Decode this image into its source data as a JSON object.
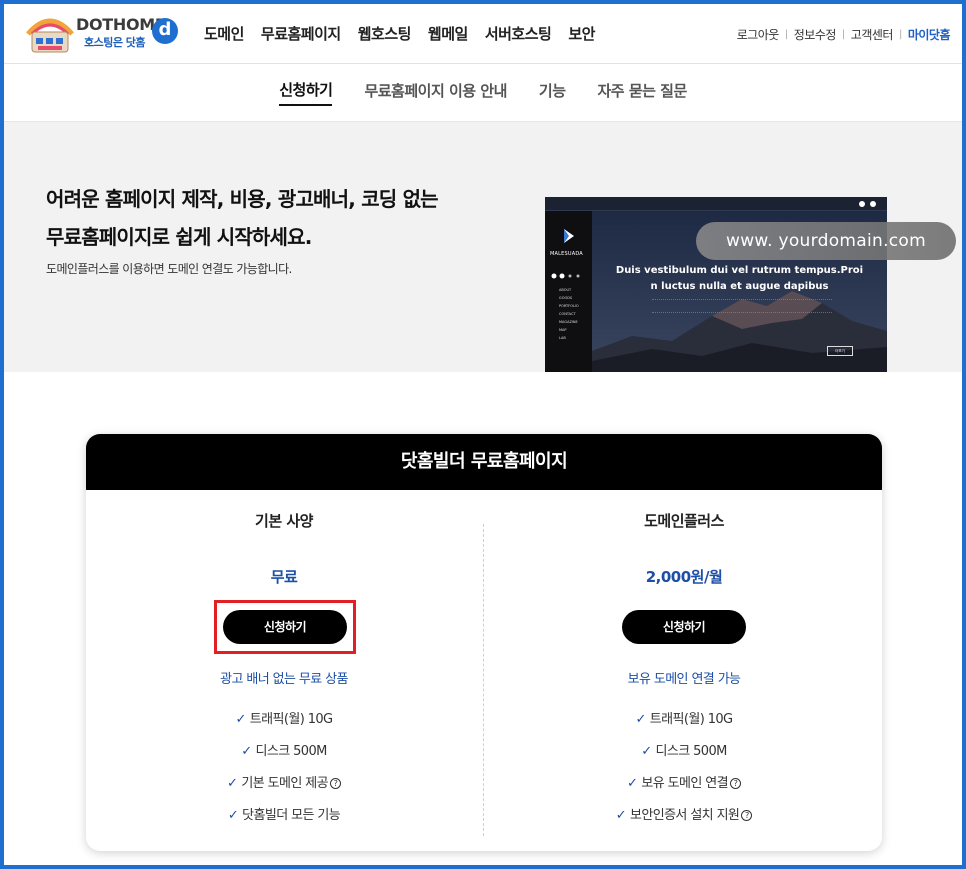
{
  "brand": {
    "name": "DOTHOME",
    "tagline": "호스팅은 닷홈",
    "badge": "d",
    "colors": {
      "accent": "#1f6fd1",
      "navy": "#1d4fa6",
      "highlight": "#e31f26"
    }
  },
  "main_nav": [
    "도메인",
    "무료홈페이지",
    "웹호스팅",
    "웹메일",
    "서버호스팅",
    "보안"
  ],
  "user_nav": {
    "logout": "로그아웃",
    "edit_info": "정보수정",
    "support": "고객센터",
    "my": "마이닷홈"
  },
  "sub_nav": {
    "items": [
      "신청하기",
      "무료홈페이지 이용 안내",
      "기능",
      "자주 묻는 질문"
    ],
    "active": "신청하기"
  },
  "hero": {
    "headline_1": "어려운 홈페이지 제작, 비용, 광고배너, 코딩 없는",
    "headline_2": "무료홈페이지로 쉽게 시작하세요.",
    "subtext": "도메인플러스를 이용하면 도메인 연결도 가능합니다.",
    "preview": {
      "brand": "MALESUADA",
      "menu": [
        "ABOUT",
        "GOODS",
        "PORTFOLIO",
        "CONTACT",
        "MAGAZINE",
        "MAP",
        "LAB"
      ],
      "title_1": "Duis vestibulum dui vel rutrum tempus.Proi",
      "title_2": "n luctus nulla et augue dapibus",
      "button": "더보기"
    },
    "url": "www. yourdomain.com"
  },
  "plans": {
    "heading": "닷홈빌더 무료홈페이지",
    "basic": {
      "title": "기본 사양",
      "price": "무료",
      "button": "신청하기",
      "tagline": "광고 배너 없는 무료 상품",
      "features": [
        "트래픽(월) 10G",
        "디스크 500M",
        "기본 도메인 제공",
        "닷홈빌더 모든 기능"
      ]
    },
    "plus": {
      "title": "도메인플러스",
      "price": "2,000원/월",
      "button": "신청하기",
      "tagline": "보유 도메인 연결 가능",
      "features": [
        "트래픽(월) 10G",
        "디스크 500M",
        "보유 도메인 연결",
        "보안인증서 설치 지원"
      ]
    }
  }
}
